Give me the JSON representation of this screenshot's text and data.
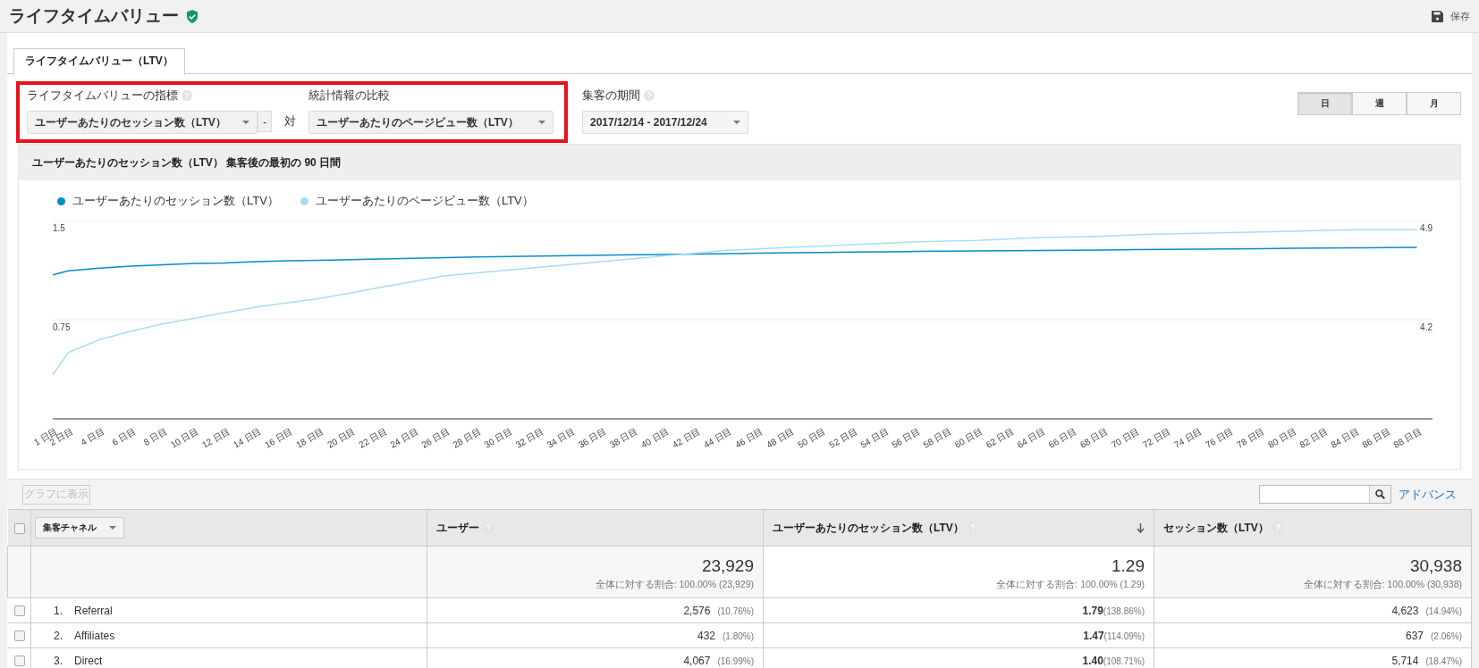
{
  "header": {
    "title": "ライフタイムバリュー",
    "save": "保存"
  },
  "tabs": [
    {
      "label": "ライフタイムバリュー（LTV）",
      "selected": true
    }
  ],
  "controls": {
    "metric": {
      "label": "ライフタイムバリューの指標",
      "value": "ユーザーあたりのセッション数（LTV）",
      "minus": "-"
    },
    "versus": "対",
    "compare": {
      "label": "統計情報の比較",
      "value": "ユーザーあたりのページビュー数（LTV）"
    },
    "period": {
      "label": "集客の期間",
      "value": "2017/12/14 - 2017/12/24"
    }
  },
  "granularity": [
    {
      "label": "日",
      "selected": true
    },
    {
      "label": "週",
      "selected": false
    },
    {
      "label": "月",
      "selected": false
    }
  ],
  "chart": {
    "heading": "ユーザーあたりのセッション数（LTV） 集客後の最初の 90 日間",
    "chart_data": {
      "type": "line",
      "categories": [
        "1 日目",
        "2 日目",
        "4 日目",
        "6 日目",
        "8 日目",
        "10 日目",
        "12 日目",
        "14 日目",
        "16 日目",
        "18 日目",
        "20 日目",
        "22 日目",
        "24 日目",
        "26 日目",
        "28 日目",
        "30 日目",
        "32 日目",
        "34 日目",
        "36 日目",
        "38 日目",
        "40 日目",
        "42 日目",
        "44 日目",
        "46 日目",
        "48 日目",
        "50 日目",
        "52 日目",
        "54 日目",
        "56 日目",
        "58 日目",
        "60 日目",
        "62 日目",
        "64 日目",
        "66 日目",
        "68 日目",
        "70 日目",
        "72 日目",
        "74 日目",
        "76 日目",
        "78 日目",
        "80 日目",
        "82 日目",
        "84 日目",
        "86 日目",
        "88 日目"
      ],
      "series": [
        {
          "name": "ユーザーあたりのセッション数（LTV）",
          "color": "#058dc7",
          "values": [
            1.09,
            1.12,
            1.14,
            1.155,
            1.165,
            1.175,
            1.18,
            1.19,
            1.195,
            1.2,
            1.205,
            1.21,
            1.215,
            1.22,
            1.225,
            1.228,
            1.232,
            1.235,
            1.238,
            1.241,
            1.244,
            1.247,
            1.25,
            1.253,
            1.256,
            1.259,
            1.262,
            1.264,
            1.266,
            1.268,
            1.27,
            1.272,
            1.274,
            1.276,
            1.278,
            1.28,
            1.282,
            1.284,
            1.286,
            1.288,
            1.29,
            1.292,
            1.294,
            1.296,
            1.297
          ]
        },
        {
          "name": "ユーザーあたりのページビュー数（LTV）",
          "color": "#a8dcf2",
          "axis": "y2",
          "values": [
            3.81,
            3.97,
            4.06,
            4.12,
            4.17,
            4.21,
            4.25,
            4.29,
            4.32,
            4.35,
            4.39,
            4.43,
            4.47,
            4.51,
            4.53,
            4.55,
            4.57,
            4.59,
            4.61,
            4.63,
            4.65,
            4.67,
            4.69,
            4.7,
            4.71,
            4.72,
            4.73,
            4.74,
            4.75,
            4.755,
            4.76,
            4.77,
            4.78,
            4.785,
            4.79,
            4.8,
            4.805,
            4.81,
            4.815,
            4.82,
            4.825,
            4.83,
            4.835,
            4.835,
            4.835
          ]
        }
      ],
      "ylim": [
        0,
        1.5
      ],
      "yticks": [
        {
          "value": 0.75,
          "label": "0.75"
        },
        {
          "value": 1.5,
          "label": "1.5"
        }
      ],
      "y2lim": [
        3.5,
        4.9
      ],
      "y2ticks": [
        {
          "value": 4.2,
          "label": "4.2"
        },
        {
          "value": 4.9,
          "label": "4.9"
        }
      ]
    }
  },
  "table": {
    "graph_button": {
      "label": "グラフに表示",
      "disabled": true
    },
    "advanced": "アドバンス",
    "select_all_checked": false,
    "dimension": "集客チャネル",
    "columns": [
      {
        "label": "ユーザー",
        "sorted": false
      },
      {
        "label": "ユーザーあたりのセッション数（LTV）",
        "sorted": true
      },
      {
        "label": "セッション数（LTV）",
        "sorted": false
      }
    ],
    "totals": [
      {
        "value": "23,929",
        "note": "全体に対する割合: 100.00% (23,929)"
      },
      {
        "value": "1.29",
        "note": "全体に対する割合: 100.00% (1.29)"
      },
      {
        "value": "30,938",
        "note": "全体に対する割合: 100.00% (30,938)"
      }
    ],
    "rows": [
      {
        "index": "1.",
        "name": "Referral",
        "checked": false,
        "cells": [
          {
            "value": "2,576",
            "pct": "(10.76%)"
          },
          {
            "value": "1.79",
            "pct": "(138.86%)"
          },
          {
            "value": "4,623",
            "pct": "(14.94%)"
          }
        ]
      },
      {
        "index": "2.",
        "name": "Affiliates",
        "checked": false,
        "cells": [
          {
            "value": "432",
            "pct": "(1.80%)"
          },
          {
            "value": "1.47",
            "pct": "(114.09%)"
          },
          {
            "value": "637",
            "pct": "(2.06%)"
          }
        ]
      },
      {
        "index": "3.",
        "name": "Direct",
        "checked": false,
        "cells": [
          {
            "value": "4,067",
            "pct": "(16.99%)"
          },
          {
            "value": "1.40",
            "pct": "(108.71%)"
          },
          {
            "value": "5,714",
            "pct": "(18.47%)"
          }
        ]
      }
    ]
  }
}
